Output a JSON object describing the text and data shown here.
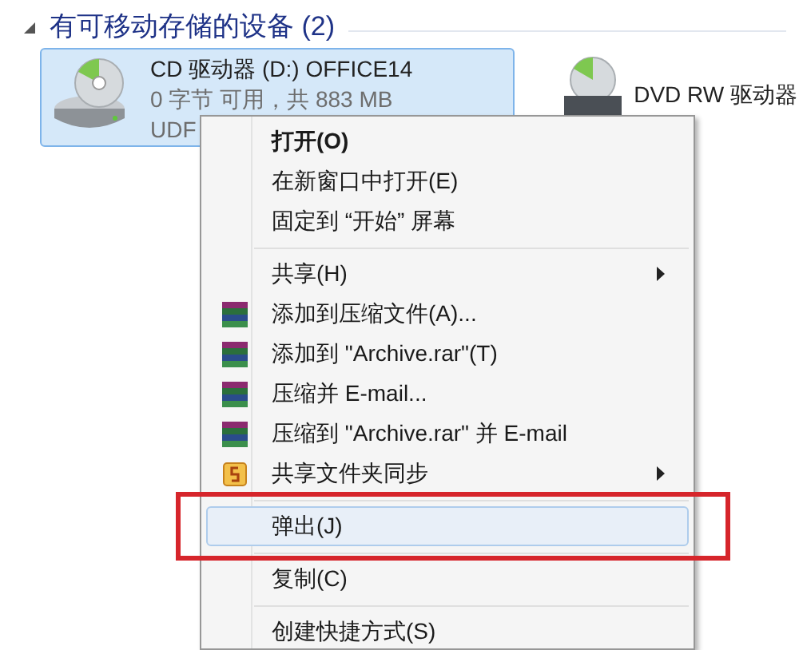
{
  "section": {
    "title": "有可移动存储的设备 (2)",
    "expanded": true
  },
  "drives": [
    {
      "kind": "cd",
      "name": "CD 驱动器 (D:) OFFICE14",
      "free": "0 字节 可用，共 883 MB",
      "fs": "UDF",
      "selected": true
    },
    {
      "kind": "dvd",
      "name": "DVD RW 驱动器",
      "selected": false
    }
  ],
  "context_menu": [
    {
      "kind": "item",
      "label": "打开(O)",
      "default": true,
      "selected": false
    },
    {
      "kind": "item",
      "label": "在新窗口中打开(E)",
      "selected": false
    },
    {
      "kind": "item",
      "label": "固定到 “开始” 屏幕",
      "selected": false
    },
    {
      "kind": "separator"
    },
    {
      "kind": "item",
      "label": "共享(H)",
      "submenu": true,
      "selected": false
    },
    {
      "kind": "archive",
      "label": "添加到压缩文件(A)...",
      "selected": false
    },
    {
      "kind": "archive",
      "label": "添加到 \"Archive.rar\"(T)",
      "selected": false
    },
    {
      "kind": "archive",
      "label": "压缩并 E-mail...",
      "selected": false
    },
    {
      "kind": "archive",
      "label": "压缩到 \"Archive.rar\" 并 E-mail",
      "selected": false
    },
    {
      "kind": "sync",
      "label": "共享文件夹同步",
      "submenu": true,
      "selected": false
    },
    {
      "kind": "separator"
    },
    {
      "kind": "item",
      "label": "弹出(J)",
      "selected": true,
      "marked": true
    },
    {
      "kind": "separator"
    },
    {
      "kind": "item",
      "label": "复制(C)",
      "selected": false
    },
    {
      "kind": "separator"
    },
    {
      "kind": "item",
      "label": "创建快捷方式(S)",
      "selected": false
    }
  ]
}
